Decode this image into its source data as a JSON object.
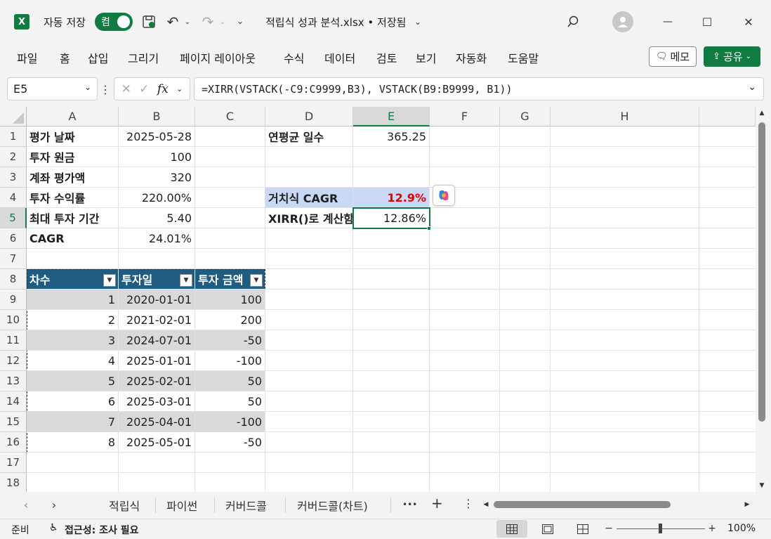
{
  "titlebar": {
    "autosave_label": "자동 저장",
    "autosave_state": "켬",
    "filename": "적립식 성과 분석.xlsx • 저장됨",
    "search_icon": "search-icon",
    "minimize_glyph": "—",
    "maximize_glyph": "☐",
    "close_glyph": "✕"
  },
  "menu": {
    "items": [
      "파일",
      "홈",
      "삽입",
      "그리기",
      "페이지 레이아웃",
      "수식",
      "데이터",
      "검토",
      "보기",
      "자동화",
      "도움말"
    ],
    "memo_label": "메모",
    "share_label": "공유"
  },
  "formula_bar": {
    "name_box": "E5",
    "fx": "fx",
    "formula": "=XIRR(VSTACK(-C9:C9999,B3), VSTACK(B9:B9999, B1))"
  },
  "grid": {
    "columns": [
      "A",
      "B",
      "C",
      "D",
      "E",
      "F",
      "G",
      "H"
    ],
    "selected_column": "E",
    "rows": [
      "1",
      "2",
      "3",
      "4",
      "5",
      "6",
      "7",
      "8",
      "9",
      "10",
      "11",
      "12",
      "13",
      "14",
      "15",
      "16",
      "17",
      "18"
    ],
    "selected_row": "5",
    "cells": {
      "A1": "평가 날짜",
      "B1": "2025-05-28",
      "A2": "투자 원금",
      "B2": "100",
      "A3": "계좌 평가액",
      "B3": "320",
      "A4": "투자 수익률",
      "B4": "220.00%",
      "A5": "최대 투자 기간",
      "B5": "5.40",
      "A6": "CAGR",
      "B6": "24.01%",
      "D1": "연평균 일수",
      "E1": "365.25",
      "D4": "거치식 CAGR",
      "E4": "12.9%",
      "D5": "XIRR()로 계산함",
      "E5": "12.86%"
    },
    "table": {
      "headers": [
        "차수",
        "투자일",
        "투자 금액"
      ],
      "rows": [
        [
          "1",
          "2020-01-01",
          "100"
        ],
        [
          "2",
          "2021-02-01",
          "200"
        ],
        [
          "3",
          "2024-07-01",
          "-50"
        ],
        [
          "4",
          "2025-01-01",
          "-100"
        ],
        [
          "5",
          "2025-02-01",
          "50"
        ],
        [
          "6",
          "2025-03-01",
          "50"
        ],
        [
          "7",
          "2025-04-01",
          "-100"
        ],
        [
          "8",
          "2025-05-01",
          "-50"
        ]
      ]
    }
  },
  "sheet_tabs": {
    "tabs": [
      "적립식",
      "파이썬",
      "커버드콜",
      "커버드콜(차트)"
    ],
    "more": "•••",
    "add": "+",
    "options": "⋮"
  },
  "status": {
    "ready": "준비",
    "accessibility": "접근성: 조사 필요",
    "zoom": "100%"
  },
  "colors": {
    "accent": "#107c41",
    "table_header": "#1f5c82",
    "band": "#d9d9d9",
    "highlight": "#c9d8f5",
    "red_text": "#e00000"
  }
}
